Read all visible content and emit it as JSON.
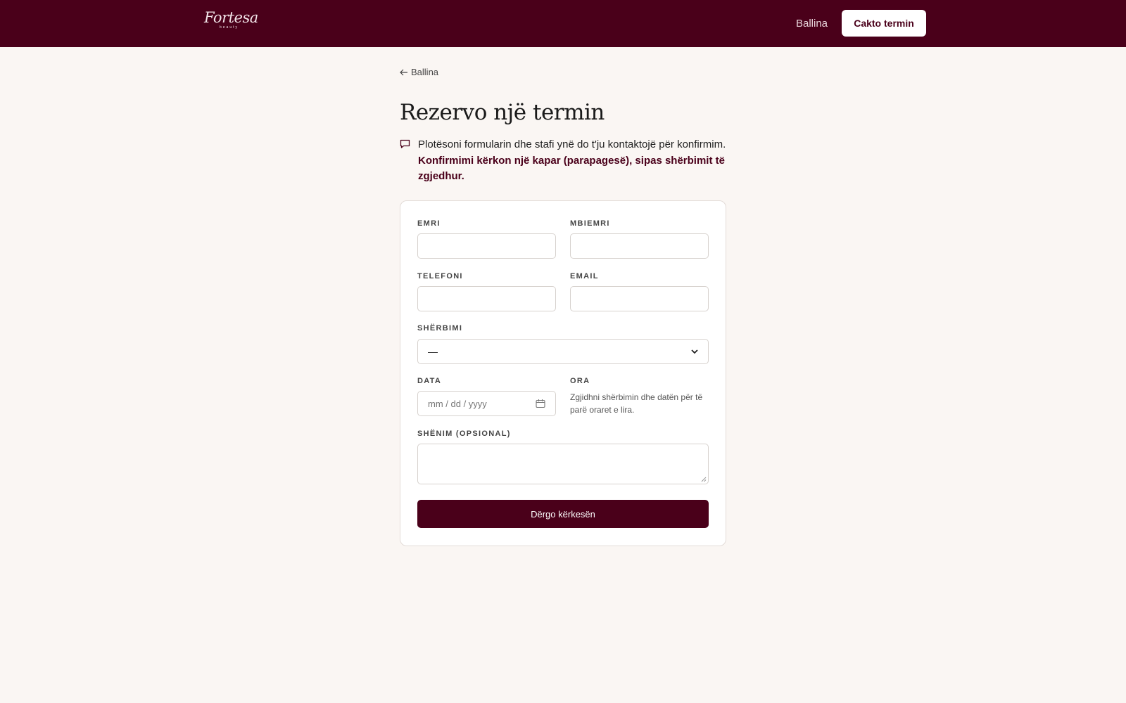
{
  "header": {
    "logo_text": "Fortesa",
    "logo_sub": "beauty",
    "nav_home": "Ballina",
    "cta_label": "Cakto termin"
  },
  "page": {
    "back_label": "Ballina",
    "title": "Rezervo një termin",
    "info_text": "Plotësoni formularin dhe stafi ynë do t'ju kontaktojë për konfirmim.",
    "info_emphasis": "Konfirmimi kërkon një kapar (parapagesë), sipas shërbimit të zgjedhur."
  },
  "form": {
    "first_name_label": "EMRI",
    "last_name_label": "MBIEMRI",
    "phone_label": "TELEFONI",
    "email_label": "EMAIL",
    "service_label": "SHËRBIMI",
    "service_value": "—",
    "date_label": "DATA",
    "date_placeholder": "mm / dd / yyyy",
    "time_label": "ORA",
    "time_hint": "Zgjidhni shërbimin dhe datën për të parë oraret e lira.",
    "note_label": "SHËNIM (OPSIONAL)",
    "submit_label": "Dërgo kërkesën"
  },
  "colors": {
    "brand": "#4a001a",
    "background": "#faf6f3"
  }
}
